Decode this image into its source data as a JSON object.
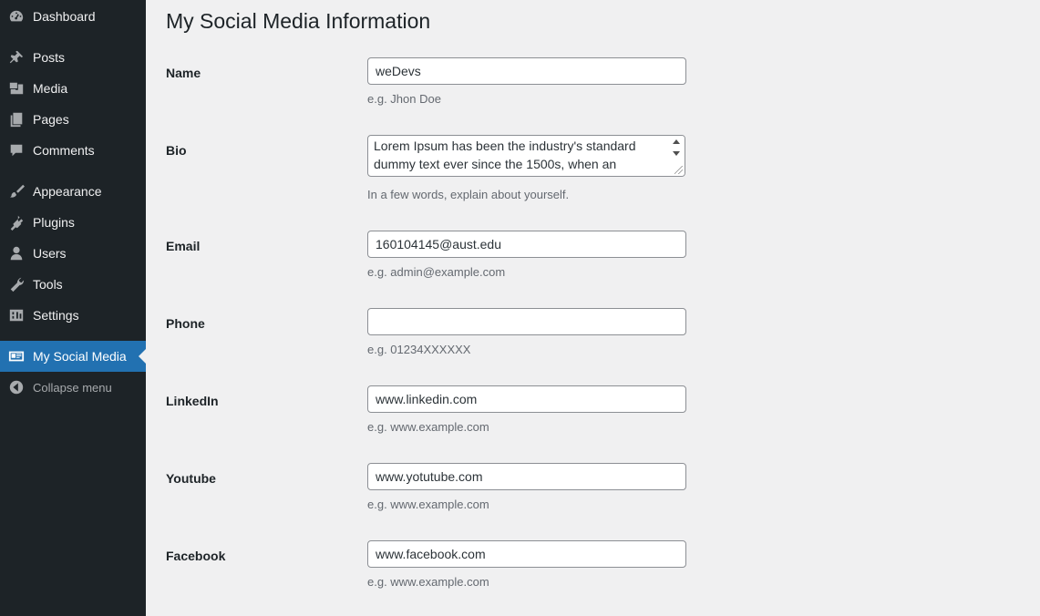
{
  "sidebar": {
    "items": [
      {
        "label": "Dashboard",
        "icon": "dashboard-icon"
      },
      {
        "label": "Posts",
        "icon": "pin-icon"
      },
      {
        "label": "Media",
        "icon": "media-icon"
      },
      {
        "label": "Pages",
        "icon": "pages-icon"
      },
      {
        "label": "Comments",
        "icon": "comment-icon"
      },
      {
        "label": "Appearance",
        "icon": "brush-icon"
      },
      {
        "label": "Plugins",
        "icon": "plug-icon"
      },
      {
        "label": "Users",
        "icon": "user-icon"
      },
      {
        "label": "Tools",
        "icon": "wrench-icon"
      },
      {
        "label": "Settings",
        "icon": "settings-icon"
      },
      {
        "label": "My Social Media",
        "icon": "id-card-icon"
      },
      {
        "label": "Collapse menu",
        "icon": "collapse-icon"
      }
    ]
  },
  "page": {
    "title": "My Social Media Information"
  },
  "form": {
    "name": {
      "label": "Name",
      "value": "weDevs",
      "hint": "e.g. Jhon Doe"
    },
    "bio": {
      "label": "Bio",
      "value": "Lorem Ipsum has been the industry's standard dummy text ever since the 1500s, when an",
      "hint": "In a few words, explain about yourself."
    },
    "email": {
      "label": "Email",
      "value": "160104145@aust.edu",
      "hint": "e.g. admin@example.com"
    },
    "phone": {
      "label": "Phone",
      "value": "",
      "hint": "e.g. 01234XXXXXX"
    },
    "linkedin": {
      "label": "LinkedIn",
      "value": "www.linkedin.com",
      "hint": "e.g. www.example.com"
    },
    "youtube": {
      "label": "Youtube",
      "value": "www.yotutube.com",
      "hint": "e.g. www.example.com"
    },
    "facebook": {
      "label": "Facebook",
      "value": "www.facebook.com",
      "hint": "e.g. www.example.com"
    }
  },
  "colors": {
    "sidebar_bg": "#1d2327",
    "active_bg": "#2271b1",
    "page_bg": "#f0f0f1"
  }
}
